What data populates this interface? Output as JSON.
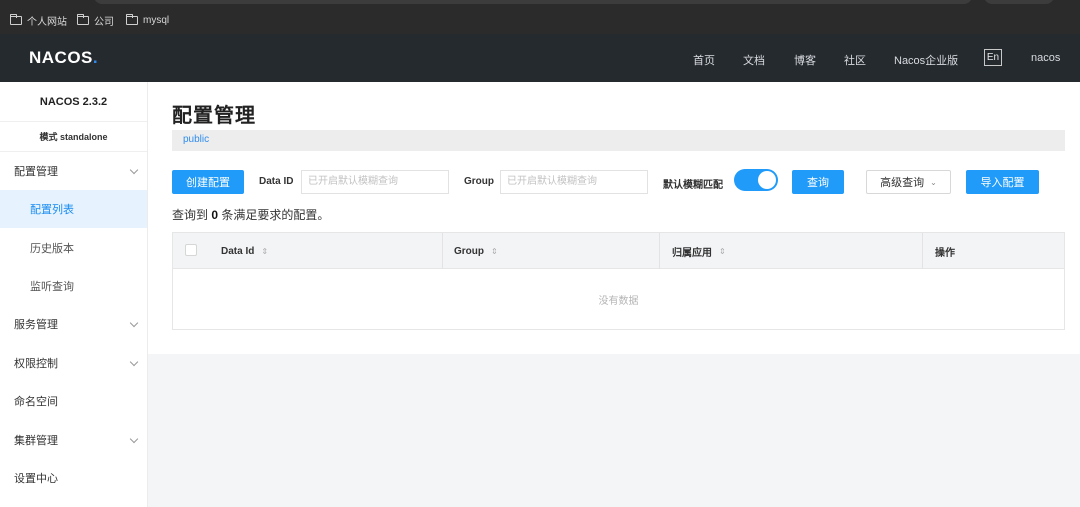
{
  "bookmarks": [
    {
      "label": "个人网站",
      "icon": "folder-icon"
    },
    {
      "label": "公司",
      "icon": "folder-icon"
    },
    {
      "label": "mysql",
      "icon": "folder-icon"
    }
  ],
  "header": {
    "logo_main": "NACOS",
    "logo_dot": ".",
    "nav": [
      "首页",
      "文档",
      "博客",
      "社区",
      "Nacos企业版"
    ],
    "lang_button": "En",
    "user": "nacos"
  },
  "sidebar": {
    "version": "NACOS 2.3.2",
    "mode": "模式 standalone",
    "items": [
      {
        "label": "配置管理",
        "expandable": true
      },
      {
        "label": "配置列表",
        "active": true
      },
      {
        "label": "历史版本"
      },
      {
        "label": "监听查询"
      },
      {
        "label": "服务管理",
        "expandable": true
      },
      {
        "label": "权限控制",
        "expandable": true
      },
      {
        "label": "命名空间"
      },
      {
        "label": "集群管理",
        "expandable": true
      },
      {
        "label": "设置中心"
      }
    ]
  },
  "main": {
    "title": "配置管理",
    "namespace": "public",
    "create_button": "创建配置",
    "data_id_label": "Data ID",
    "data_id_placeholder": "已开启默认模糊查询",
    "group_label": "Group",
    "group_placeholder": "已开启默认模糊查询",
    "fuzzy_label": "默认模糊匹配",
    "fuzzy_enabled": true,
    "search_button": "查询",
    "advanced_button": "高级查询",
    "import_button": "导入配置",
    "result_prefix": "查询到",
    "result_count": "0",
    "result_suffix": "条满足要求的配置。",
    "table": {
      "columns": [
        "Data Id",
        "Group",
        "归属应用",
        "操作"
      ],
      "empty_text": "没有数据"
    }
  },
  "colors": {
    "accent": "#209bfa",
    "header_bg": "#252a2f",
    "active_bg": "#e6f3ff"
  }
}
